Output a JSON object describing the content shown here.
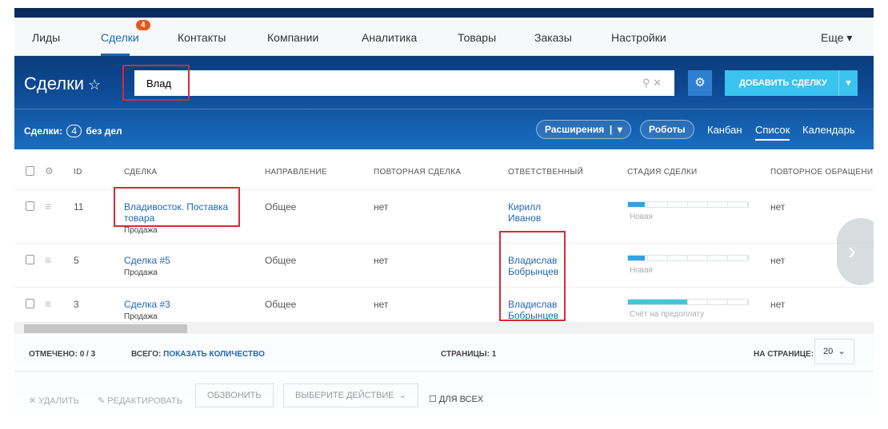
{
  "nav": {
    "items": [
      "Лиды",
      "Сделки",
      "Контакты",
      "Компании",
      "Аналитика",
      "Товары",
      "Заказы",
      "Настройки"
    ],
    "active": "Сделки",
    "badge": "4",
    "more": "Еще"
  },
  "header": {
    "title": "Сделки",
    "search_value": "Влад",
    "add_button": "ДОБАВИТЬ СДЕЛКУ"
  },
  "toolbar": {
    "count_label": "Сделки:",
    "count": "4",
    "no_tasks": "без дел",
    "extensions": "Расширения",
    "robots": "Роботы",
    "views": [
      "Канбан",
      "Список",
      "Календарь"
    ],
    "active_view": "Список"
  },
  "table": {
    "columns": [
      "ID",
      "СДЕЛКА",
      "НАПРАВЛЕНИЕ",
      "ПОВТОРНАЯ СДЕЛКА",
      "ОТВЕТСТВЕННЫЙ",
      "СТАДИЯ СДЕЛКИ",
      "ПОВТОРНОЕ ОБРАЩЕНИ"
    ],
    "rows": [
      {
        "id": "11",
        "deal": "Владивосток. Поставка товара",
        "type": "Продажа",
        "direction": "Общее",
        "repeat": "нет",
        "responsible": "Кирилл Иванов",
        "stage": "Новая",
        "stage_progress": 0.14,
        "stage_color": "#2fa4e7",
        "repeat_appeal": "нет"
      },
      {
        "id": "5",
        "deal": "Сделка #5",
        "type": "Продажа",
        "direction": "Общее",
        "repeat": "нет",
        "responsible": "Владислав Бобрынцев",
        "stage": "Новая",
        "stage_progress": 0.14,
        "stage_color": "#2fa4e7",
        "repeat_appeal": "нет"
      },
      {
        "id": "3",
        "deal": "Сделка #3",
        "type": "Продажа",
        "direction": "Общее",
        "repeat": "нет",
        "responsible": "Владислав Бобрынцев",
        "stage": "Счёт на предоплату",
        "stage_progress": 0.49,
        "stage_color": "#3ec8d8",
        "repeat_appeal": "нет"
      }
    ]
  },
  "footer": {
    "selected": "ОТМЕЧЕНО: 0 / 3",
    "total_label": "ВСЕГО:",
    "show_count": "ПОКАЗАТЬ КОЛИЧЕСТВО",
    "pages": "СТРАНИЦЫ: 1",
    "per_page_label": "НА СТРАНИЦЕ:",
    "per_page": "20"
  },
  "actions": {
    "delete": "УДАЛИТЬ",
    "edit": "РЕДАКТИРОВАТЬ",
    "call": "ОБЗВОНИТЬ",
    "choose": "ВЫБЕРИТЕ ДЕЙСТВИЕ",
    "for_all": "ДЛЯ ВСЕХ"
  }
}
